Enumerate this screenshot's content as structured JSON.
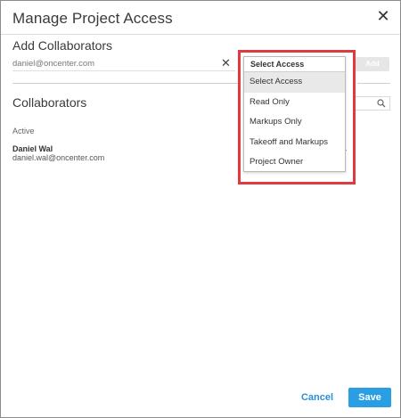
{
  "dialog": {
    "title": "Manage Project Access",
    "close_icon": "close-icon"
  },
  "add_section": {
    "title": "Add Collaborators",
    "email_value": "daniel@oncenter.com",
    "clear_icon": "clear-icon",
    "add_label": "Add"
  },
  "access_dropdown": {
    "header": "Select Access",
    "options": [
      {
        "label": "Select Access",
        "selected": true
      },
      {
        "label": "Read Only",
        "selected": false
      },
      {
        "label": "Markups Only",
        "selected": false
      },
      {
        "label": "Takeoff and Markups",
        "selected": false
      },
      {
        "label": "Project Owner",
        "selected": false
      }
    ]
  },
  "collaborators": {
    "title": "Collaborators",
    "search_icon": "search-icon",
    "status": "Active",
    "user": {
      "name": "Daniel Wal",
      "email": "daniel.wal@oncenter.com"
    }
  },
  "footer": {
    "cancel_label": "Cancel",
    "save_label": "Save"
  },
  "colors": {
    "accent": "#2a9ee3",
    "link": "#2a8ed8",
    "highlight": "#e03a3f"
  }
}
